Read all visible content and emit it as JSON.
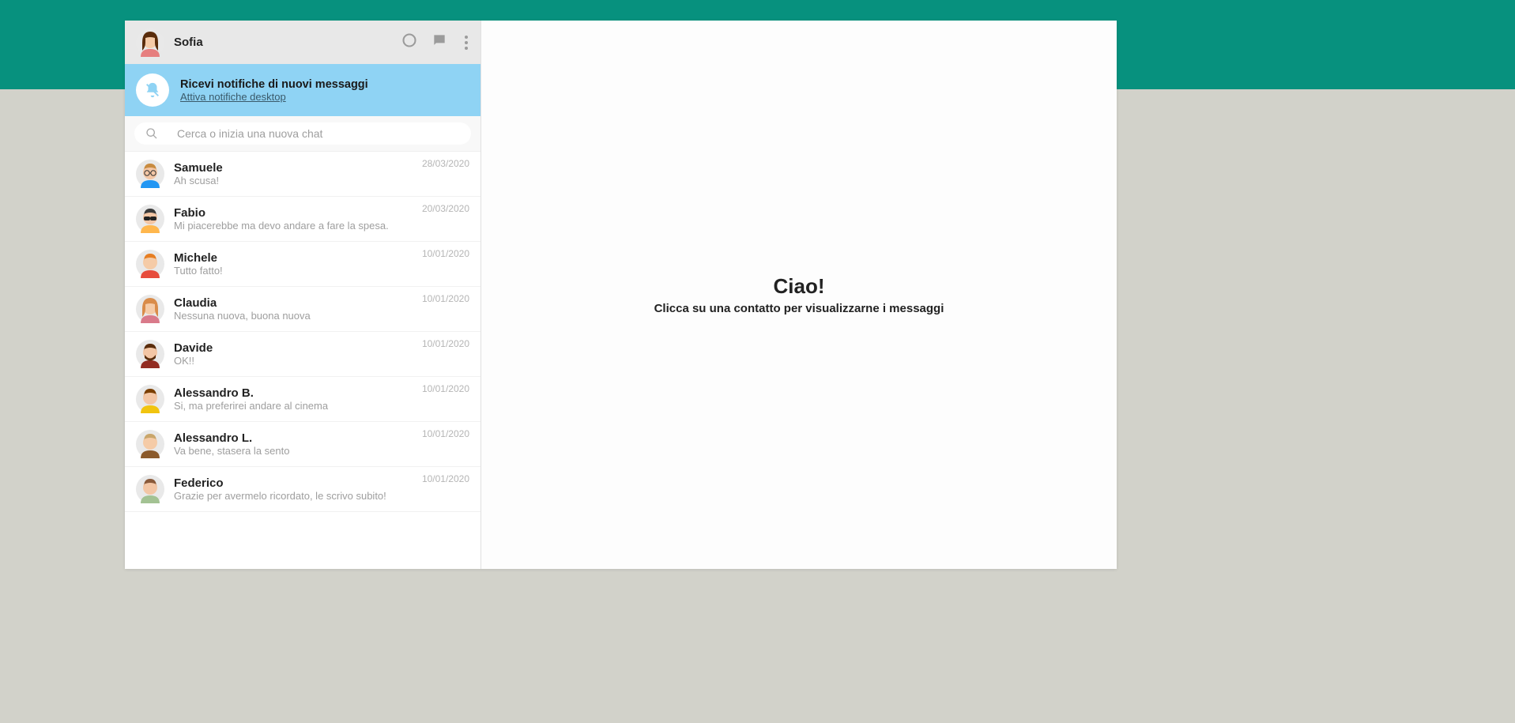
{
  "header": {
    "user_name": "Sofia"
  },
  "notification": {
    "title": "Ricevi notifiche di nuovi messaggi",
    "link": "Attiva notifiche desktop"
  },
  "search": {
    "placeholder": "Cerca o inizia una nuova chat"
  },
  "chats": [
    {
      "name": "Samuele",
      "preview": "Ah scusa!",
      "date": "28/03/2020",
      "avatar": {
        "hair": "#c88b40",
        "skin": "#f3c6a5",
        "shirt": "#2196f3",
        "glasses": true
      }
    },
    {
      "name": "Fabio",
      "preview": "Mi piacerebbe ma devo andare a fare la spesa.",
      "date": "20/03/2020",
      "avatar": {
        "hair": "#3a3a3a",
        "skin": "#f3c6a5",
        "shirt": "#ffb74d",
        "sunglasses": true
      }
    },
    {
      "name": "Michele",
      "preview": "Tutto fatto!",
      "date": "10/01/2020",
      "avatar": {
        "hair": "#e67e22",
        "skin": "#f5cba7",
        "shirt": "#e74c3c"
      }
    },
    {
      "name": "Claudia",
      "preview": "Nessuna nuova, buona nuova",
      "date": "10/01/2020",
      "avatar": {
        "hair": "#d98c4a",
        "skin": "#f5cba7",
        "shirt": "#d97a8a",
        "female": true
      }
    },
    {
      "name": "Davide",
      "preview": "OK!!",
      "date": "10/01/2020",
      "avatar": {
        "hair": "#5a2d0c",
        "skin": "#f3c6a5",
        "shirt": "#922b21",
        "beard": "#5a2d0c"
      }
    },
    {
      "name": "Alessandro B.",
      "preview": "Si, ma preferirei andare al cinema",
      "date": "10/01/2020",
      "avatar": {
        "hair": "#7b3f00",
        "skin": "#f3c6a5",
        "shirt": "#f1c40f"
      }
    },
    {
      "name": "Alessandro L.",
      "preview": "Va bene, stasera la sento",
      "date": "10/01/2020",
      "avatar": {
        "hair": "#c9a66b",
        "skin": "#f5cba7",
        "shirt": "#8b5a2b"
      }
    },
    {
      "name": "Federico",
      "preview": "Grazie per avermelo ricordato, le scrivo subito!",
      "date": "10/01/2020",
      "avatar": {
        "hair": "#8a5a3a",
        "skin": "#f3c6a5",
        "shirt": "#a3c293"
      }
    }
  ],
  "main": {
    "title": "Ciao!",
    "subtitle": "Clicca su una contatto per visualizzarne i messaggi"
  },
  "self_avatar": {
    "hair": "#5a2d0c",
    "skin": "#f5cba7",
    "shirt": "#e67e7e",
    "female": true
  }
}
